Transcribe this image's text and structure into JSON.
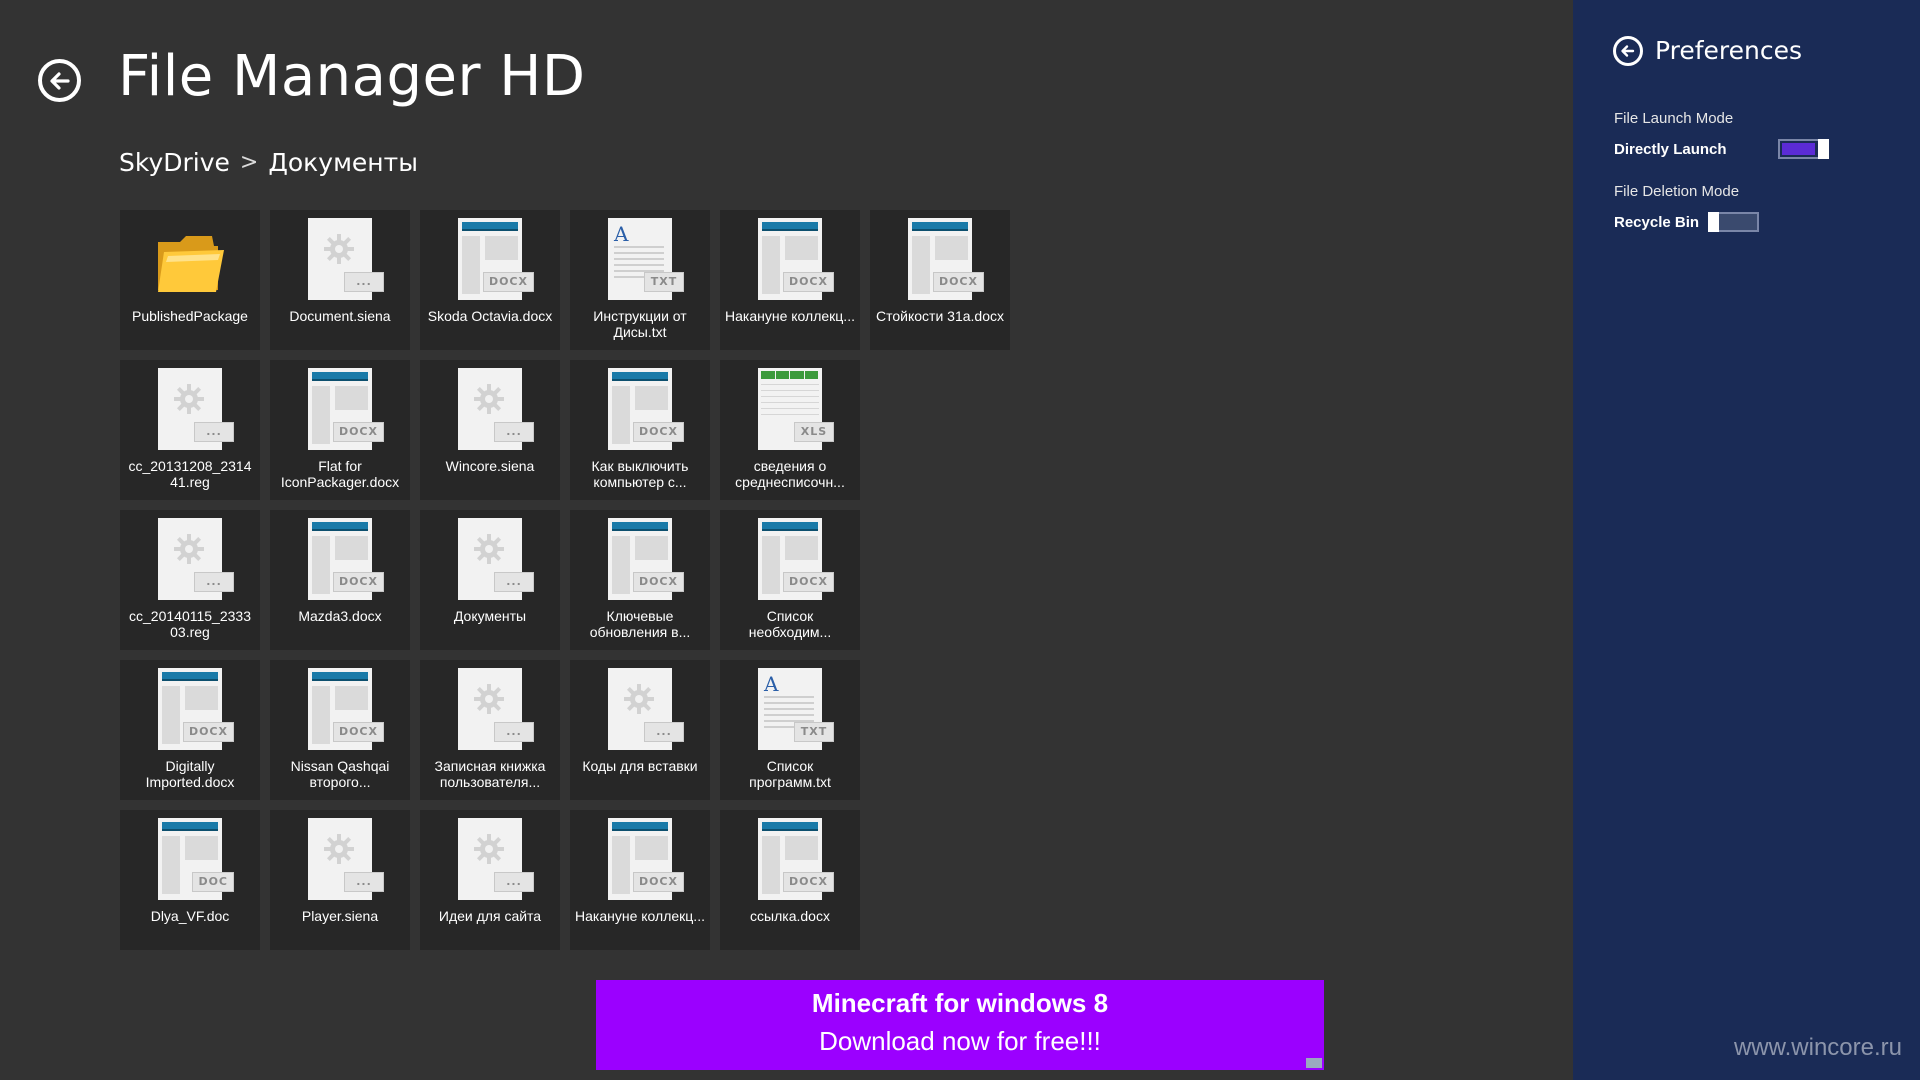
{
  "app": {
    "title": "File Manager HD"
  },
  "breadcrumb": {
    "root": "SkyDrive",
    "separator": ">",
    "current": "Документы"
  },
  "files": [
    {
      "name": "PublishedPackage",
      "kind": "folder"
    },
    {
      "name": "Document.siena",
      "kind": "generic",
      "badge": "..."
    },
    {
      "name": "Skoda Octavia.docx",
      "kind": "docx",
      "badge": "DOCX"
    },
    {
      "name": "Инструкции от Дисы.txt",
      "kind": "txt",
      "badge": "TXT"
    },
    {
      "name": "Накануне коллекц...",
      "kind": "docx",
      "badge": "DOCX"
    },
    {
      "name": "Стойкости 31a.docx",
      "kind": "docx",
      "badge": "DOCX"
    },
    {
      "name": "cc_20131208_2314 41.reg",
      "kind": "generic",
      "badge": "..."
    },
    {
      "name": "Flat for IconPackager.docx",
      "kind": "docx",
      "badge": "DOCX"
    },
    {
      "name": "Wincore.siena",
      "kind": "generic",
      "badge": "..."
    },
    {
      "name": "Как выключить компьютер с...",
      "kind": "docx",
      "badge": "DOCX"
    },
    {
      "name": "сведения о среднесписочн...",
      "kind": "xls",
      "badge": "XLS"
    },
    {
      "name": "",
      "kind": "empty"
    },
    {
      "name": "cc_20140115_2333 03.reg",
      "kind": "generic",
      "badge": "..."
    },
    {
      "name": "Mazda3.docx",
      "kind": "docx",
      "badge": "DOCX"
    },
    {
      "name": "Документы",
      "kind": "generic",
      "badge": "..."
    },
    {
      "name": "Ключевые обновления в...",
      "kind": "docx",
      "badge": "DOCX"
    },
    {
      "name": "Список необходим...",
      "kind": "docx",
      "badge": "DOCX"
    },
    {
      "name": "",
      "kind": "empty"
    },
    {
      "name": "Digitally Imported.docx",
      "kind": "docx",
      "badge": "DOCX"
    },
    {
      "name": "Nissan Qashqai второго...",
      "kind": "docx",
      "badge": "DOCX"
    },
    {
      "name": "Записная книжка пользователя...",
      "kind": "generic",
      "badge": "..."
    },
    {
      "name": "Коды для вставки",
      "kind": "generic",
      "badge": "..."
    },
    {
      "name": "Список программ.txt",
      "kind": "txt",
      "badge": "TXT"
    },
    {
      "name": "",
      "kind": "empty"
    },
    {
      "name": "Dlya_VF.doc",
      "kind": "docx",
      "badge": "DOC"
    },
    {
      "name": "Player.siena",
      "kind": "generic",
      "badge": "..."
    },
    {
      "name": "Идеи для сайта",
      "kind": "generic",
      "badge": "..."
    },
    {
      "name": "Накануне коллекц...",
      "kind": "docx",
      "badge": "DOCX"
    },
    {
      "name": "ссылка.docx",
      "kind": "docx",
      "badge": "DOCX"
    }
  ],
  "ad": {
    "line1": "Minecraft for windows 8",
    "line2": "Download now for free!!!",
    "color": "#9b00ff"
  },
  "preferences": {
    "title": "Preferences",
    "launch_mode_label": "File Launch Mode",
    "launch_mode_value": "Directly Launch",
    "launch_toggle_on": true,
    "deletion_mode_label": "File Deletion Mode",
    "deletion_mode_value": "Recycle Bin",
    "deletion_toggle_on": false,
    "accent": "#5b2bd6",
    "pane_color": "#1a2b56"
  },
  "watermark": "www.wincore.ru"
}
